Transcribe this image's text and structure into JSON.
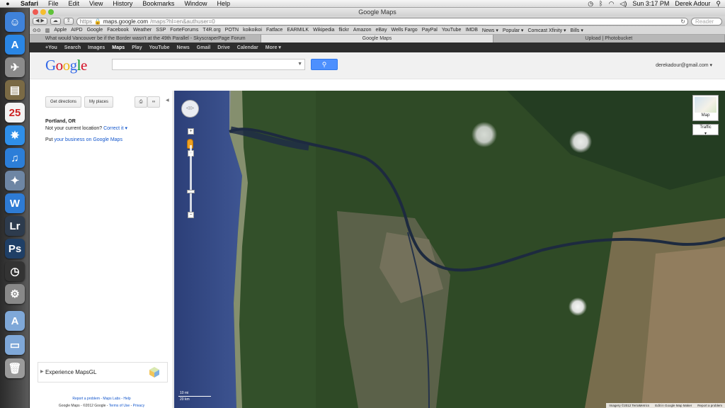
{
  "menubar": {
    "apple": "",
    "items": [
      "Safari",
      "File",
      "Edit",
      "View",
      "History",
      "Bookmarks",
      "Window",
      "Help"
    ],
    "clock": "Sun 3:17 PM",
    "user": "Derek Adour"
  },
  "dock": {
    "icons": [
      {
        "name": "finder-icon",
        "color": "#3f82d9",
        "glyph": "☺"
      },
      {
        "name": "app-store-icon",
        "color": "#2a86e4",
        "glyph": "A"
      },
      {
        "name": "launchpad-icon",
        "color": "#8b8b8b",
        "glyph": "✈"
      },
      {
        "name": "folder-stack-icon",
        "color": "#7a6a45",
        "glyph": "▤"
      },
      {
        "name": "calendar-icon",
        "color": "#f3f3f3",
        "glyph": "25"
      },
      {
        "name": "safari-icon",
        "color": "#2f8fe8",
        "glyph": "✵"
      },
      {
        "name": "itunes-icon",
        "color": "#2c7ed8",
        "glyph": "♫"
      },
      {
        "name": "preview-icon",
        "color": "#6e86a4",
        "glyph": "✦"
      },
      {
        "name": "word-icon",
        "color": "#2e7bd4",
        "glyph": "W"
      },
      {
        "name": "lightroom-icon",
        "color": "#2d3b4d",
        "glyph": "Lr"
      },
      {
        "name": "photoshop-icon",
        "color": "#1f3f66",
        "glyph": "Ps"
      },
      {
        "name": "time-machine-icon",
        "color": "#333333",
        "glyph": "◷"
      },
      {
        "name": "system-preferences-icon",
        "color": "#888888",
        "glyph": "⚙"
      },
      {
        "name": "applications-folder-icon",
        "color": "#7fa8d8",
        "glyph": "A"
      },
      {
        "name": "documents-folder-icon",
        "color": "#7fa8d8",
        "glyph": "▭"
      },
      {
        "name": "trash-icon",
        "color": "#9a9a9a",
        "glyph": "🗑"
      }
    ]
  },
  "browser": {
    "title": "Google Maps",
    "url_scheme": "https",
    "url_host": "maps.google.com",
    "url_path": "/maps?hl=en&authuser=0",
    "search_placeholder": "Reader",
    "bookmarks": [
      "Apple",
      "AIPD",
      "Google",
      "Facebook",
      "Weather",
      "SSP",
      "ForteForums",
      "T4R.org",
      "POTN",
      "koikoikoi",
      "Fatface",
      "EARMILK",
      "Wikipedia",
      "flickr",
      "Amazon",
      "eBay",
      "Wells Fargo",
      "PayPal",
      "YouTube",
      "IMDB",
      "News ▾",
      "Popular ▾",
      "Comcast Xfinity ▾",
      "Bills ▾"
    ],
    "tabs": [
      {
        "label": "What would Vancouver be if the Border wasn't at the 49th Parallel - SkyscraperPage Forum",
        "active": false
      },
      {
        "label": "Google Maps",
        "active": true
      },
      {
        "label": "Upload | Photobucket",
        "active": false
      }
    ]
  },
  "gbar": {
    "items": [
      "+You",
      "Search",
      "Images",
      "Maps",
      "Play",
      "YouTube",
      "News",
      "Gmail",
      "Drive",
      "Calendar",
      "More ▾"
    ],
    "active": "Maps"
  },
  "header": {
    "logo": "Google",
    "account": "derekadour@gmail.com ▾"
  },
  "panel": {
    "get_directions": "Get directions",
    "my_places": "My places",
    "place_title": "Portland, OR",
    "not_location": "Not your current location?",
    "correct_it": "Correct it ▾",
    "put_prefix": "Put ",
    "put_link": "your business on Google Maps",
    "mapsgl": "Experience MapsGL",
    "footer_links": "Report a problem - Maps Labs - Help",
    "footer_prefix": "Google Maps - ©2012 Google - ",
    "footer_terms": "Terms of Use",
    "footer_sep": " - ",
    "footer_privacy": "Privacy"
  },
  "map": {
    "maptype_label": "Map",
    "traffic_label": "Traffic",
    "scale_mi": "10 mi",
    "scale_km": "20 km",
    "attribution": "Imagery ©2012 TerraMetrics",
    "edit_link": "Edit in Google Map Maker",
    "report_link": "Report a problem"
  }
}
